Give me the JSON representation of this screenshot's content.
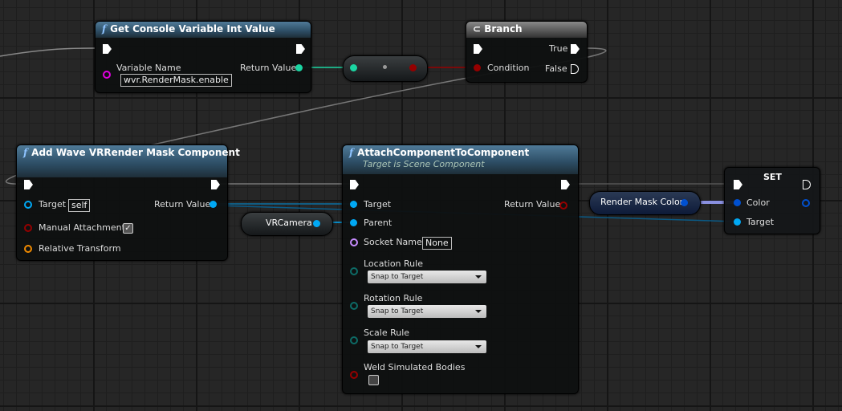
{
  "colors": {
    "exec": "#ffffff",
    "object": "#00a8f4",
    "int": "#1bd5a2",
    "bool": "#950000",
    "name": "#c78cff",
    "string": "#e000e0",
    "transform": "#f08a00",
    "enum": "#0d6b66",
    "struct": "#0050d0"
  },
  "nodes": {
    "get_cvar": {
      "title": "Get Console Variable Int Value",
      "variable_name_label": "Variable Name",
      "variable_name_value": "wvr.RenderMask.enable",
      "return_label": "Return Value"
    },
    "branch": {
      "title": "Branch",
      "condition_label": "Condition",
      "true_label": "True",
      "false_label": "False"
    },
    "add_mask": {
      "title": "Add Wave VRRender Mask Component",
      "target_label": "Target",
      "target_value": "self",
      "return_label": "Return Value",
      "manual_label": "Manual Attachment",
      "manual_checked": true,
      "transform_label": "Relative Transform"
    },
    "vrcamera": {
      "label": "VRCamera"
    },
    "attach": {
      "title": "AttachComponentToComponent",
      "subtitle": "Target is Scene Component",
      "target_label": "Target",
      "return_label": "Return Value",
      "parent_label": "Parent",
      "socket_label": "Socket Name",
      "socket_value": "None",
      "location_label": "Location Rule",
      "location_value": "Snap to Target",
      "rotation_label": "Rotation Rule",
      "rotation_value": "Snap to Target",
      "scale_label": "Scale Rule",
      "scale_value": "Snap to Target",
      "weld_label": "Weld Simulated Bodies",
      "weld_checked": false
    },
    "render_mask_color": {
      "label": "Render Mask Color"
    },
    "set": {
      "title": "SET",
      "color_label": "Color",
      "target_label": "Target"
    }
  }
}
